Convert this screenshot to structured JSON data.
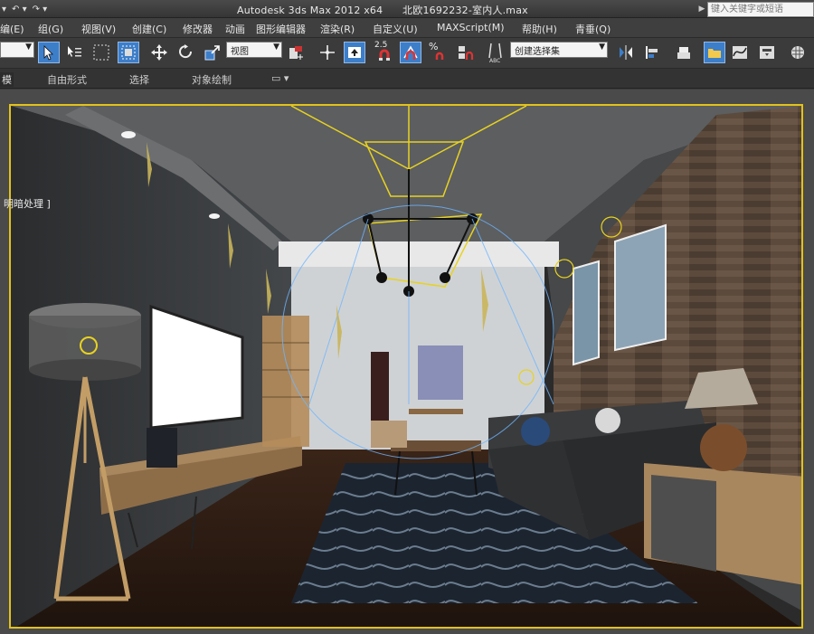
{
  "titlebar": {
    "app": "Autodesk 3ds Max  2012 x64",
    "file": "北欧1692232-室内人.max",
    "search_placeholder": "键入关键字或短语"
  },
  "menu": [
    {
      "label": "编(E)"
    },
    {
      "label": "组(G)"
    },
    {
      "label": "视图(V)"
    },
    {
      "label": "创建(C)"
    },
    {
      "label": "修改器"
    },
    {
      "label": "动画"
    },
    {
      "label": "图形编辑器"
    },
    {
      "label": "渲染(R)"
    },
    {
      "label": "自定义(U)"
    },
    {
      "label": "MAXScript(M)"
    },
    {
      "label": "帮助(H)"
    },
    {
      "label": "青垂(Q)"
    }
  ],
  "toolbar": {
    "reference_coord": "视图",
    "snap_angle": "2.5",
    "percent_snap": "%",
    "selection_set": "创建选择集"
  },
  "ribbon_tabs": [
    {
      "label": "模"
    },
    {
      "label": "自由形式"
    },
    {
      "label": "选择"
    },
    {
      "label": "对象绘制"
    }
  ],
  "viewport": {
    "label": "明暗处理 ]"
  },
  "colors": {
    "accent": "#3d7ec9",
    "viewport_border": "#e2c21a",
    "gizmo": "#e8d21f",
    "light_line": "#6fb6ff"
  }
}
